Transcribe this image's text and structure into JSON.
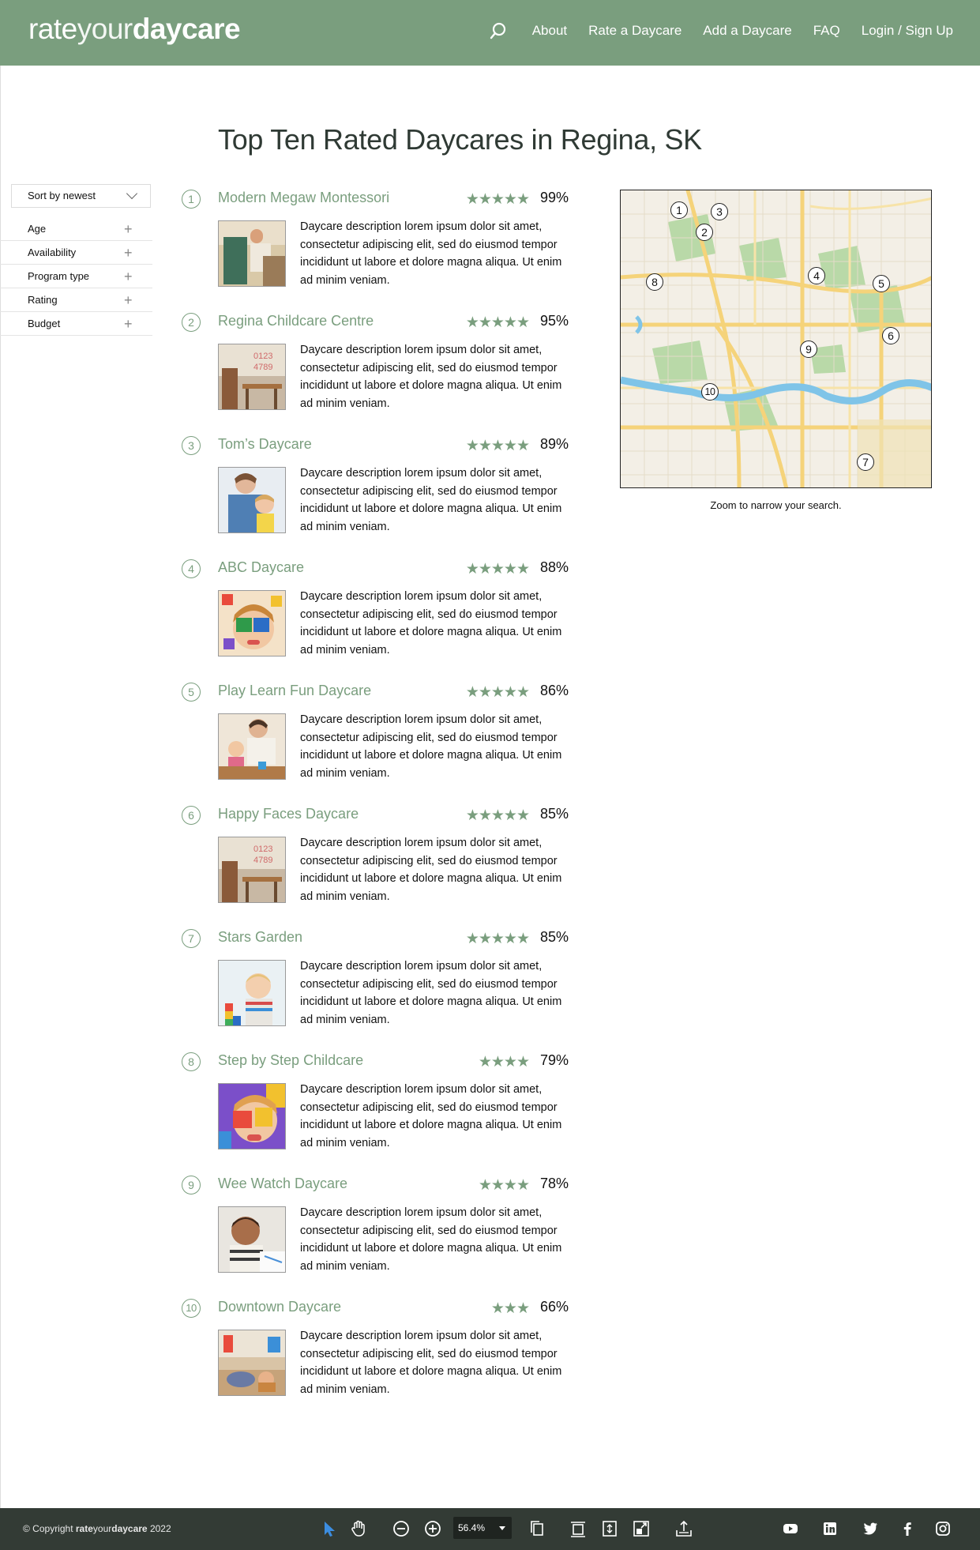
{
  "header": {
    "logo": {
      "part1": "rate",
      "part2": "your",
      "part3": "daycare"
    },
    "nav": [
      "About",
      "Rate a Daycare",
      "Add a Daycare",
      "FAQ",
      "Login / Sign Up"
    ]
  },
  "page_title": "Top Ten Rated Daycares in Regina, SK",
  "sidebar": {
    "sort_label": "Sort by newest",
    "filters": [
      "Age",
      "Availability",
      "Program type",
      "Rating",
      "Budget"
    ]
  },
  "daycares": [
    {
      "rank": "1",
      "name": "Modern Megaw Montessori",
      "stars": "★★★★★",
      "percent": "99%",
      "description": "Daycare description lorem ipsum dolor sit amet, consectetur adipiscing elit, sed do eiusmod tempor incididunt ut labore et dolore magna aliqua. Ut enim ad minim veniam."
    },
    {
      "rank": "2",
      "name": "Regina Childcare Centre",
      "stars": "★★★★★",
      "percent": "95%",
      "description": "Daycare description lorem ipsum dolor sit amet, consectetur adipiscing elit, sed do eiusmod tempor incididunt ut labore et dolore magna aliqua. Ut enim ad minim veniam."
    },
    {
      "rank": "3",
      "name": "Tom’s Daycare",
      "stars": "★★★★★",
      "percent": "89%",
      "description": "Daycare description lorem ipsum dolor sit amet, consectetur adipiscing elit, sed do eiusmod tempor incididunt ut labore et dolore magna aliqua. Ut enim ad minim veniam."
    },
    {
      "rank": "4",
      "name": "ABC Daycare",
      "stars": "★★★★★",
      "percent": "88%",
      "description": "Daycare description lorem ipsum dolor sit amet, consectetur adipiscing elit, sed do eiusmod tempor incididunt ut labore et dolore magna aliqua. Ut enim ad minim veniam."
    },
    {
      "rank": "5",
      "name": "Play Learn Fun Daycare",
      "stars": "★★★★★",
      "percent": "86%",
      "description": "Daycare description lorem ipsum dolor sit amet, consectetur adipiscing elit, sed do eiusmod tempor incididunt ut labore et dolore magna aliqua. Ut enim ad minim veniam."
    },
    {
      "rank": "6",
      "name": "Happy Faces Daycare",
      "stars": "★★★★★",
      "percent": "85%",
      "description": "Daycare description lorem ipsum dolor sit amet, consectetur adipiscing elit, sed do eiusmod tempor incididunt ut labore et dolore magna aliqua. Ut enim ad minim veniam."
    },
    {
      "rank": "7",
      "name": "Stars Garden",
      "stars": "★★★★★",
      "percent": "85%",
      "description": "Daycare description lorem ipsum dolor sit amet, consectetur adipiscing elit, sed do eiusmod tempor incididunt ut labore et dolore magna aliqua. Ut enim ad minim veniam."
    },
    {
      "rank": "8",
      "name": "Step by Step Childcare",
      "stars": "★★★★",
      "percent": "79%",
      "description": "Daycare description lorem ipsum dolor sit amet, consectetur adipiscing elit, sed do eiusmod tempor incididunt ut labore et dolore magna aliqua. Ut enim ad minim veniam."
    },
    {
      "rank": "9",
      "name": "Wee Watch Daycare",
      "stars": "★★★★",
      "percent": "78%",
      "description": "Daycare description lorem ipsum dolor sit amet, consectetur adipiscing elit, sed do eiusmod tempor incididunt ut labore et dolore magna aliqua. Ut enim ad minim veniam."
    },
    {
      "rank": "10",
      "name": "Downtown Daycare",
      "stars": "★★★",
      "percent": "66%",
      "description": "Daycare description lorem ipsum dolor sit amet, consectetur adipiscing elit, sed do eiusmod tempor incididunt ut labore et dolore magna aliqua. Ut enim ad minim veniam."
    }
  ],
  "map": {
    "pins": [
      "1",
      "2",
      "3",
      "4",
      "5",
      "6",
      "7",
      "8",
      "9",
      "10"
    ],
    "caption": "Zoom to narrow your search."
  },
  "footer": {
    "copyright_prefix": "© Copyright ",
    "brand_part1": "rate",
    "brand_part2": "your",
    "brand_part3": "daycare",
    "year": " 2022",
    "zoom": "56.4%",
    "toolbar_icons": [
      "pointer-icon",
      "hand-icon",
      "zoom-out-icon",
      "zoom-in-icon",
      "copy-icon",
      "fit-icon",
      "expand-icon",
      "fullscreen-icon",
      "export-icon"
    ],
    "social_icons": [
      "youtube-icon",
      "linkedin-icon",
      "twitter-icon",
      "facebook-icon",
      "instagram-icon"
    ]
  },
  "colors": {
    "brand": "#7a9e7e",
    "footer": "#333b35",
    "text": "#111111"
  }
}
